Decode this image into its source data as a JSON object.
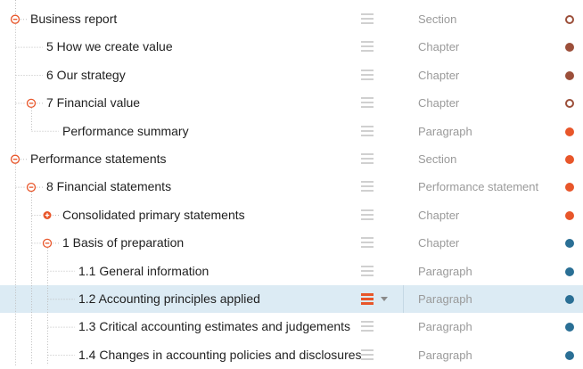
{
  "colors": {
    "section": "#9c4f3a",
    "content": "#e8562a",
    "note": "#2a6f95",
    "selected_bg": "#dcebf4",
    "toggle": "#e8562a"
  },
  "rows": [
    {
      "label": "Business report",
      "type": "Section",
      "level": 0,
      "toggle": "expanded",
      "dot": "hollow",
      "color": "#9c4f3a"
    },
    {
      "label": "5 How we create value",
      "type": "Chapter",
      "level": 1,
      "toggle": "none",
      "dot": "filled",
      "color": "#9c4f3a"
    },
    {
      "label": "6 Our strategy",
      "type": "Chapter",
      "level": 1,
      "toggle": "none",
      "dot": "filled",
      "color": "#9c4f3a"
    },
    {
      "label": "7 Financial value",
      "type": "Chapter",
      "level": 1,
      "toggle": "expanded",
      "dot": "hollow",
      "color": "#9c4f3a"
    },
    {
      "label": "Performance summary",
      "type": "Paragraph",
      "level": 2,
      "toggle": "none",
      "dot": "filled",
      "color": "#e8562a"
    },
    {
      "label": "Performance statements",
      "type": "Section",
      "level": 0,
      "toggle": "expanded",
      "dot": "filled",
      "color": "#e8562a"
    },
    {
      "label": "8 Financial statements",
      "type": "Performance statement",
      "level": 1,
      "toggle": "expanded",
      "dot": "filled",
      "color": "#e8562a"
    },
    {
      "label": "Consolidated primary statements",
      "type": "Chapter",
      "level": 2,
      "toggle": "collapsed",
      "dot": "filled",
      "color": "#e8562a"
    },
    {
      "label": "1 Basis of preparation",
      "type": "Chapter",
      "level": 2,
      "toggle": "expanded",
      "dot": "filled",
      "color": "#2a6f95"
    },
    {
      "label": "1.1 General information",
      "type": "Paragraph",
      "level": 3,
      "toggle": "none",
      "dot": "filled",
      "color": "#2a6f95"
    },
    {
      "label": "1.2 Accounting principles applied",
      "type": "Paragraph",
      "level": 3,
      "toggle": "none",
      "dot": "filled",
      "color": "#2a6f95",
      "selected": true
    },
    {
      "label": "1.3 Critical accounting estimates and judgements",
      "type": "Paragraph",
      "level": 3,
      "toggle": "none",
      "dot": "filled",
      "color": "#2a6f95"
    },
    {
      "label": "1.4 Changes in accounting policies and disclosures",
      "type": "Paragraph",
      "level": 3,
      "toggle": "none",
      "dot": "filled",
      "color": "#2a6f95"
    }
  ]
}
